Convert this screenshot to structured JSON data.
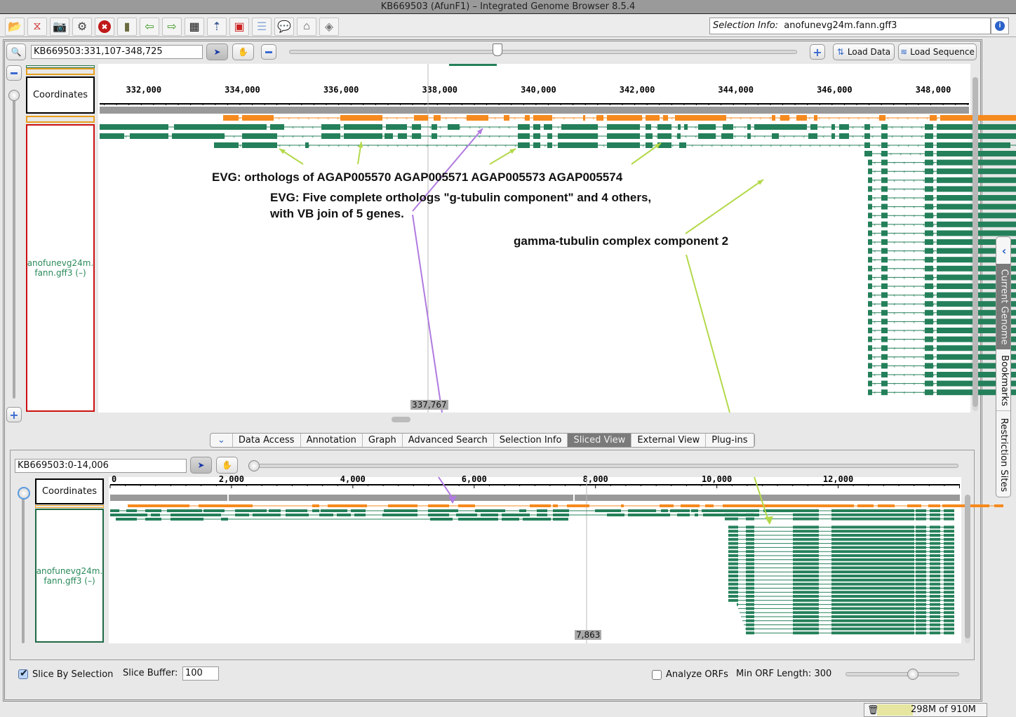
{
  "window": {
    "title": "KB669503  (AfunF1) – Integrated Genome Browser 8.5.4"
  },
  "toolbar": {
    "icons": [
      "open-file-icon",
      "dna-icon",
      "camera-icon",
      "gear-icon",
      "stop-icon",
      "book-icon",
      "back-arrow-icon",
      "forward-arrow-icon",
      "film-icon",
      "track-up-icon",
      "track-red-icon",
      "list-icon",
      "speech-bubble-icon",
      "home-icon",
      "graph-icon"
    ],
    "selection_info_label": "Selection Info:",
    "selection_info_value": "anofunevg24m.fann.gff3"
  },
  "nav": {
    "location": "KB669503:331,107-348,725",
    "load_data": "Load Data",
    "load_sequence": "Load Sequence",
    "zoom_fraction": 0.41
  },
  "main_view": {
    "coordinates_label": "Coordinates",
    "track_label": "anofunevg24m.\nfann.gff3 (–)",
    "axis": {
      "start": 331107,
      "end": 348725,
      "ticks": [
        "332,000",
        "334,000",
        "336,000",
        "338,000",
        "340,000",
        "342,000",
        "344,000",
        "346,000",
        "348,000"
      ]
    },
    "cursor_position": "337,767"
  },
  "annotations": {
    "line1": "EVG: orthologs of AGAP005570 AGAP005571 AGAP005573 AGAP005574",
    "line2a": "EVG: Five complete orthologs \"g-tubulin component\" and 4 others,",
    "line2b": "with VB join of 5 genes.",
    "line3": "gamma-tubulin complex component 2"
  },
  "bottom_tabs": [
    "Data Access",
    "Annotation",
    "Graph",
    "Advanced Search",
    "Selection Info",
    "Sliced View",
    "External View",
    "Plug-ins"
  ],
  "active_tab": "Sliced View",
  "side_tabs": [
    "Current Genome",
    "Bookmarks",
    "Restriction Sites"
  ],
  "sliced_view": {
    "location": "KB669503:0-14,006",
    "coordinates_label": "Coordinates",
    "track_label": "anofunevg24m.\nfann.gff3 (–)",
    "axis": {
      "start": 0,
      "end": 14006,
      "ticks": [
        "0",
        "2,000",
        "4,000",
        "6,000",
        "8,000",
        "10,000",
        "12,000"
      ]
    },
    "cursor_position": "7,863",
    "slice_by_selection_label": "Slice By Selection",
    "slice_by_selection": true,
    "slice_buffer_label": "Slice Buffer:",
    "slice_buffer": "100",
    "analyze_orfs_label": "Analyze ORFs",
    "analyze_orfs": false,
    "min_orf_label": "Min ORF Length:",
    "min_orf_value": "300",
    "min_orf_slider_fraction": 0.59
  },
  "status": {
    "memory": "298M of 910M",
    "memory_fraction": 0.33
  },
  "colors": {
    "gene_green": "#24805a",
    "gene_orange": "#f58a1e",
    "arrow_green": "#b3d94a",
    "arrow_purple": "#b07ae0"
  }
}
